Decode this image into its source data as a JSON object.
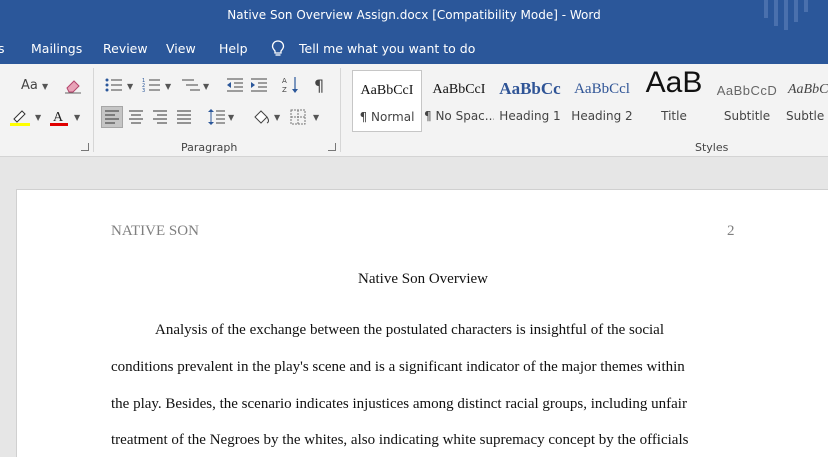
{
  "window": {
    "title": "Native Son Overview Assign.docx [Compatibility Mode]  -  Word"
  },
  "menu": {
    "items": [
      "s",
      "Mailings",
      "Review",
      "View",
      "Help"
    ],
    "tell_me": "Tell me what you want to do"
  },
  "ribbon": {
    "font_group": {
      "change_case": "Aa",
      "clear_formatting_icon": "eraser-icon",
      "highlight_icon": "highlighter-icon",
      "font_color_icon": "font-color-icon"
    },
    "paragraph_group": {
      "label": "Paragraph",
      "sort_glyph": "↓",
      "pilcrow": "¶"
    },
    "styles_group": {
      "label": "Styles",
      "tiles": [
        {
          "sample": "AaBbCcI",
          "name": "¶ Normal"
        },
        {
          "sample": "AaBbCcI",
          "name": "¶ No Spac..."
        },
        {
          "sample": "AaBbCc",
          "name": "Heading 1"
        },
        {
          "sample": "AaBbCcl",
          "name": "Heading 2"
        },
        {
          "sample": "AaB",
          "name": "Title"
        },
        {
          "sample": "AaBbCcD",
          "name": "Subtitle"
        },
        {
          "sample": "AaBbC",
          "name": "Subtle E"
        }
      ]
    }
  },
  "document": {
    "header_left": "NATIVE SON",
    "page_number": "2",
    "title": "Native Son Overview",
    "lines": [
      "Analysis of the exchange between the postulated characters is insightful of the social",
      "conditions prevalent in the play's scene and is a significant indicator of the major themes within",
      "the play. Besides, the scenario indicates injustices among distinct racial groups, including unfair",
      "treatment of the Negroes by the whites, also indicating white supremacy concept by the officials"
    ]
  },
  "colors": {
    "word_blue": "#2b579a",
    "ribbon_bg": "#f3f3f3",
    "heading_blue": "#2f5496"
  }
}
